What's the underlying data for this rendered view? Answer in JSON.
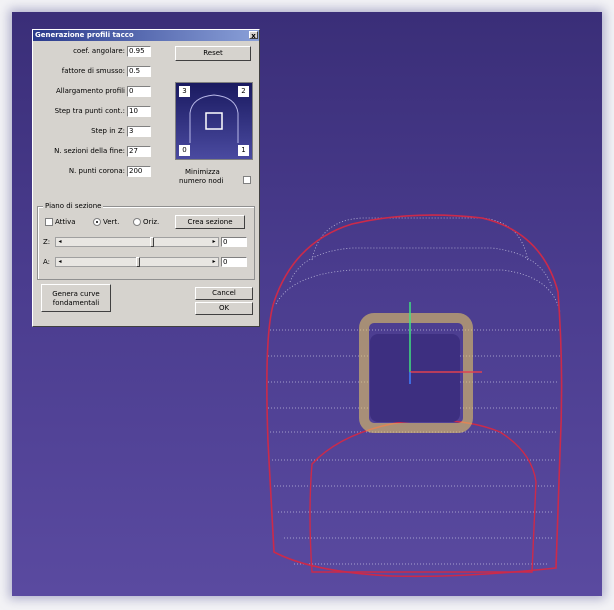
{
  "dialog": {
    "title": "Generazione profili tacco",
    "close_label": "x",
    "fields": [
      {
        "label": "coef. angolare:",
        "value": "0.95"
      },
      {
        "label": "fattore di smusso:",
        "value": "0.5"
      },
      {
        "label": "Allargamento profili",
        "value": "0"
      },
      {
        "label": "Step tra punti cont.:",
        "value": "10"
      },
      {
        "label": "Step in Z:",
        "value": "3"
      },
      {
        "label": "N. sezioni della fine:",
        "value": "27"
      },
      {
        "label": "N. punti corona:",
        "value": "200"
      }
    ],
    "reset_label": "Reset",
    "corners": [
      "3",
      "2",
      "0",
      "1"
    ],
    "minimize_label_1": "Minimizza",
    "minimize_label_2": "numero nodi",
    "section_group_label": "Piano di sezione",
    "attiva_label": "Attiva",
    "vert_label": "Vert.",
    "oriz_label": "Oriz.",
    "crea_sezione_label": "Crea sezione",
    "z_label": "Z:",
    "z_value": "0",
    "a_label": "A:",
    "a_value": "0",
    "genera_label_1": "Genera curve",
    "genera_label_2": "fondamentali",
    "cancel_label": "Cancel",
    "ok_label": "OK",
    "z_slider_level": 0.6,
    "a_slider_level": 0.5
  },
  "colors": {
    "viewport_bg": "#4a3c8e",
    "outline": "#cc2a4a",
    "dots": "#e0e0f0",
    "glow": "#f0d060",
    "titlebar": "#2a3a8c"
  }
}
